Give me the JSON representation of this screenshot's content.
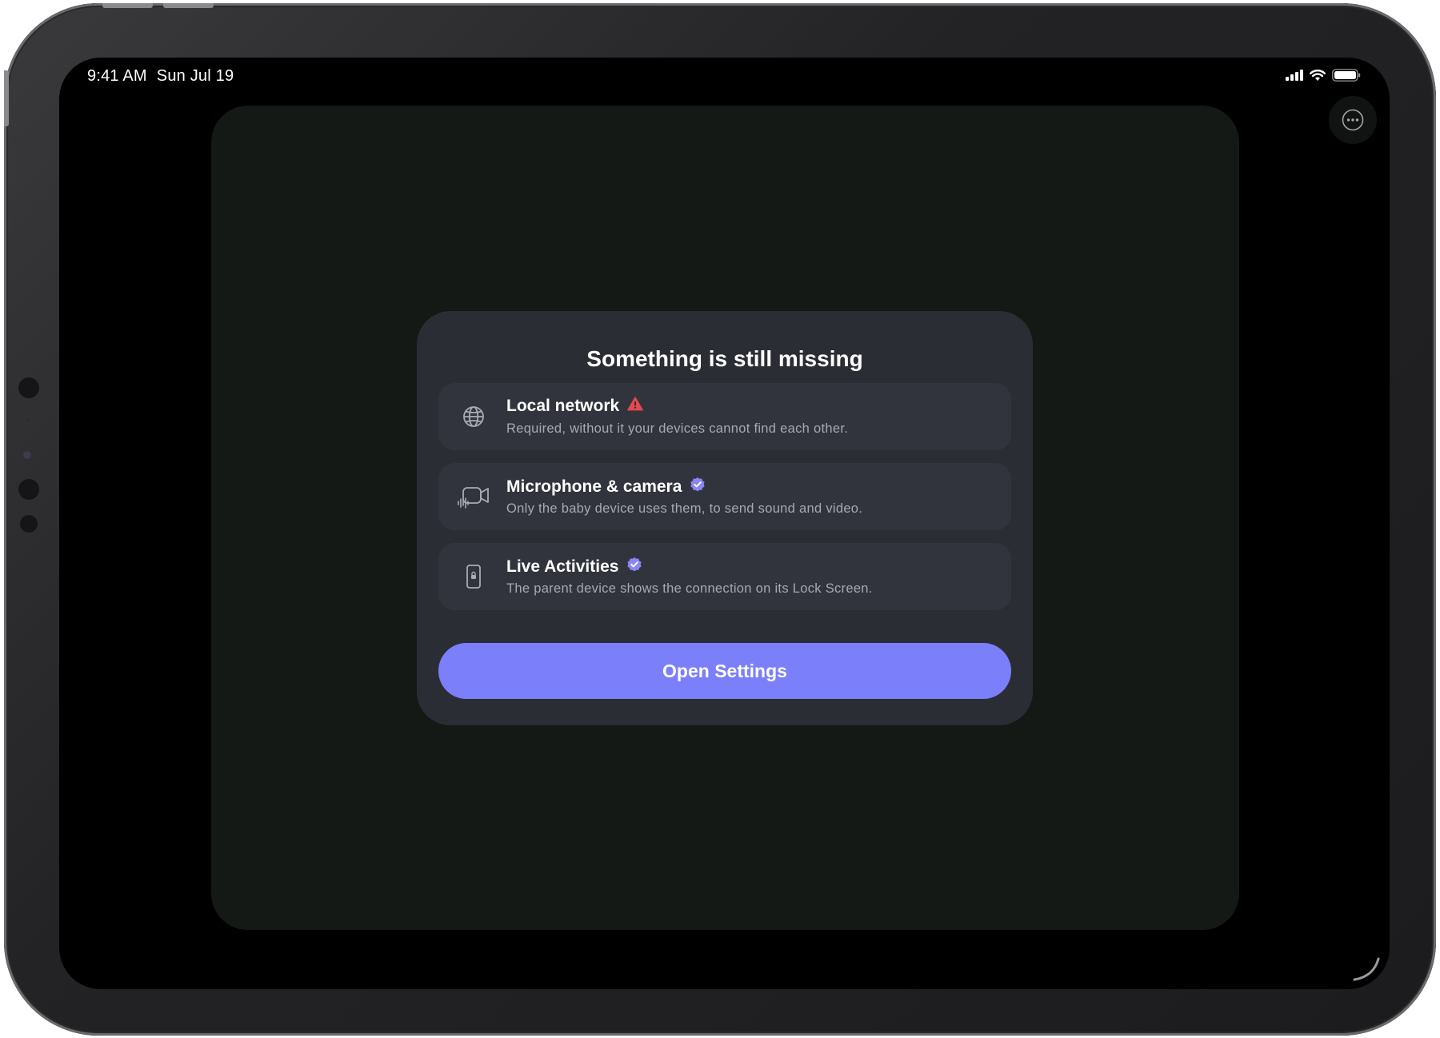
{
  "status_bar": {
    "time": "9:41 AM",
    "date": "Sun Jul 19"
  },
  "colors": {
    "accent": "#7b7ffa",
    "warning": "#e5484d",
    "verified": "#8b86f5",
    "card": "#2b2d35",
    "panel": "#141915"
  },
  "dialog": {
    "title": "Something is still missing",
    "items": [
      {
        "icon": "globe-icon",
        "label": "Local network",
        "status_icon": "warning-triangle-icon",
        "description": "Required, without it your devices cannot find each other."
      },
      {
        "icon": "video-camera-icon",
        "label": "Microphone & camera",
        "status_icon": "verified-check-icon",
        "description": "Only the baby device uses them, to send sound and video."
      },
      {
        "icon": "lock-phone-icon",
        "label": "Live Activities",
        "status_icon": "verified-check-icon",
        "description": "The parent device shows the connection on its Lock Screen."
      }
    ],
    "primary_button": "Open Settings"
  }
}
